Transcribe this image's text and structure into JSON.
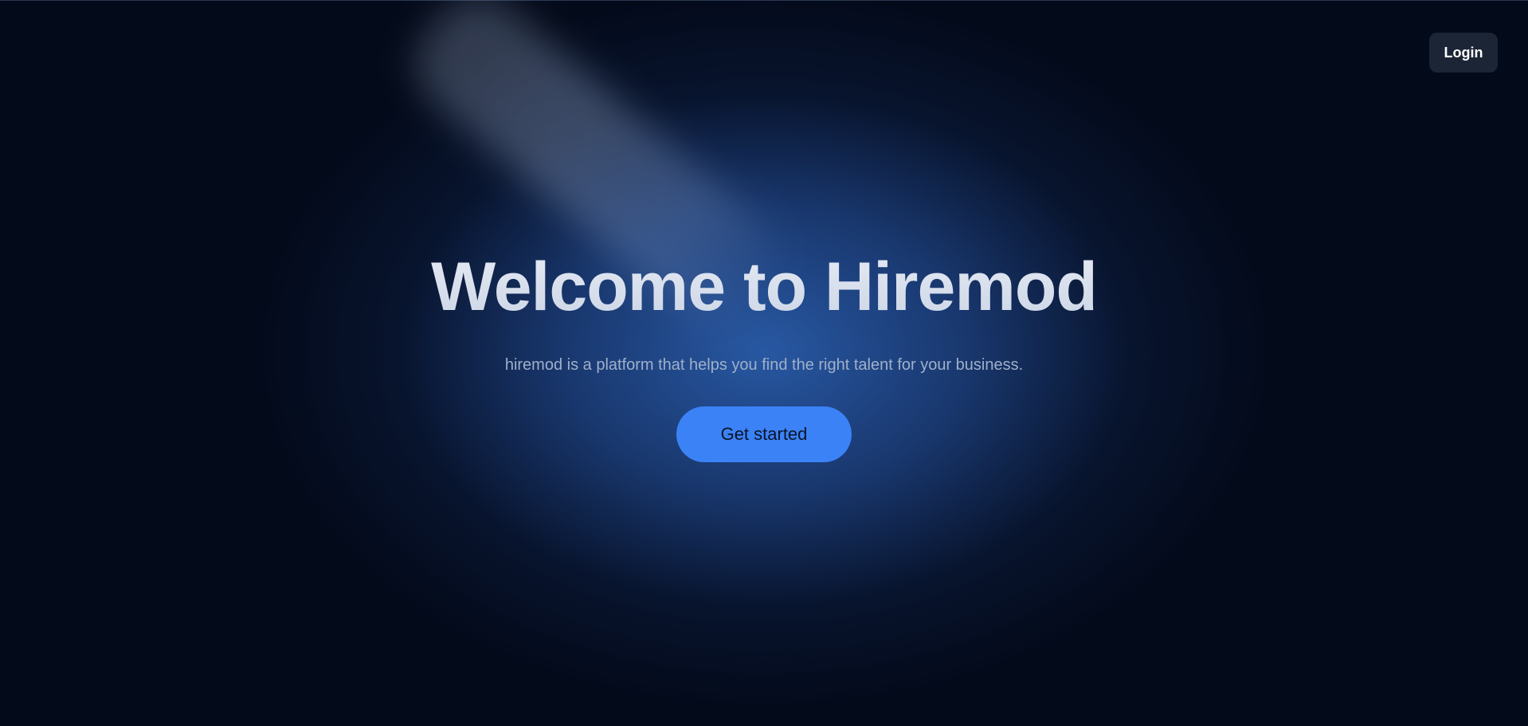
{
  "header": {
    "login_label": "Login"
  },
  "hero": {
    "title": "Welcome to Hiremod",
    "subtitle": "hiremod is a platform that helps you find the right talent for your business.",
    "cta_label": "Get started"
  },
  "colors": {
    "background": "#030a1a",
    "glow": "#2a5caa",
    "accent": "#3b82f6",
    "login_bg": "#1c2536"
  }
}
